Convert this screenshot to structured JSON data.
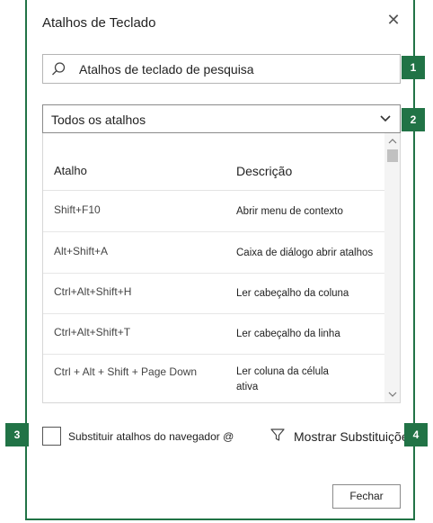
{
  "dialog": {
    "title": "Atalhos de Teclado",
    "close_icon": "close-icon"
  },
  "search": {
    "icon": "search-icon",
    "text": "Atalhos de teclado de pesquisa"
  },
  "filter_dropdown": {
    "selected": "Todos os atalhos",
    "icon": "chevron-down-icon"
  },
  "table": {
    "columns": [
      "Atalho",
      "Descrição"
    ],
    "rows": [
      {
        "shortcut": "Shift+F10",
        "description": "Abrir menu de contexto"
      },
      {
        "shortcut": "Alt+Shift+A",
        "description": "Caixa de diálogo abrir atalhos"
      },
      {
        "shortcut": "Ctrl+Alt+Shift+H",
        "description": "Ler cabeçalho da coluna"
      },
      {
        "shortcut": "Ctrl+Alt+Shift+T",
        "description": "Ler cabeçalho da linha"
      },
      {
        "shortcut": "Ctrl + Alt + Shift + Page Down",
        "description": "Ler coluna da célula ativa"
      }
    ]
  },
  "override_checkbox": {
    "label": "Substituir atalhos do navegador @",
    "checked": false
  },
  "show_overrides": {
    "icon": "filter-icon",
    "label": "Mostrar Substituições"
  },
  "footer": {
    "close_label": "Fechar"
  },
  "callouts": [
    "1",
    "2",
    "3",
    "4"
  ],
  "colors": {
    "accent": "#217346",
    "border": "#b5b5b5"
  }
}
